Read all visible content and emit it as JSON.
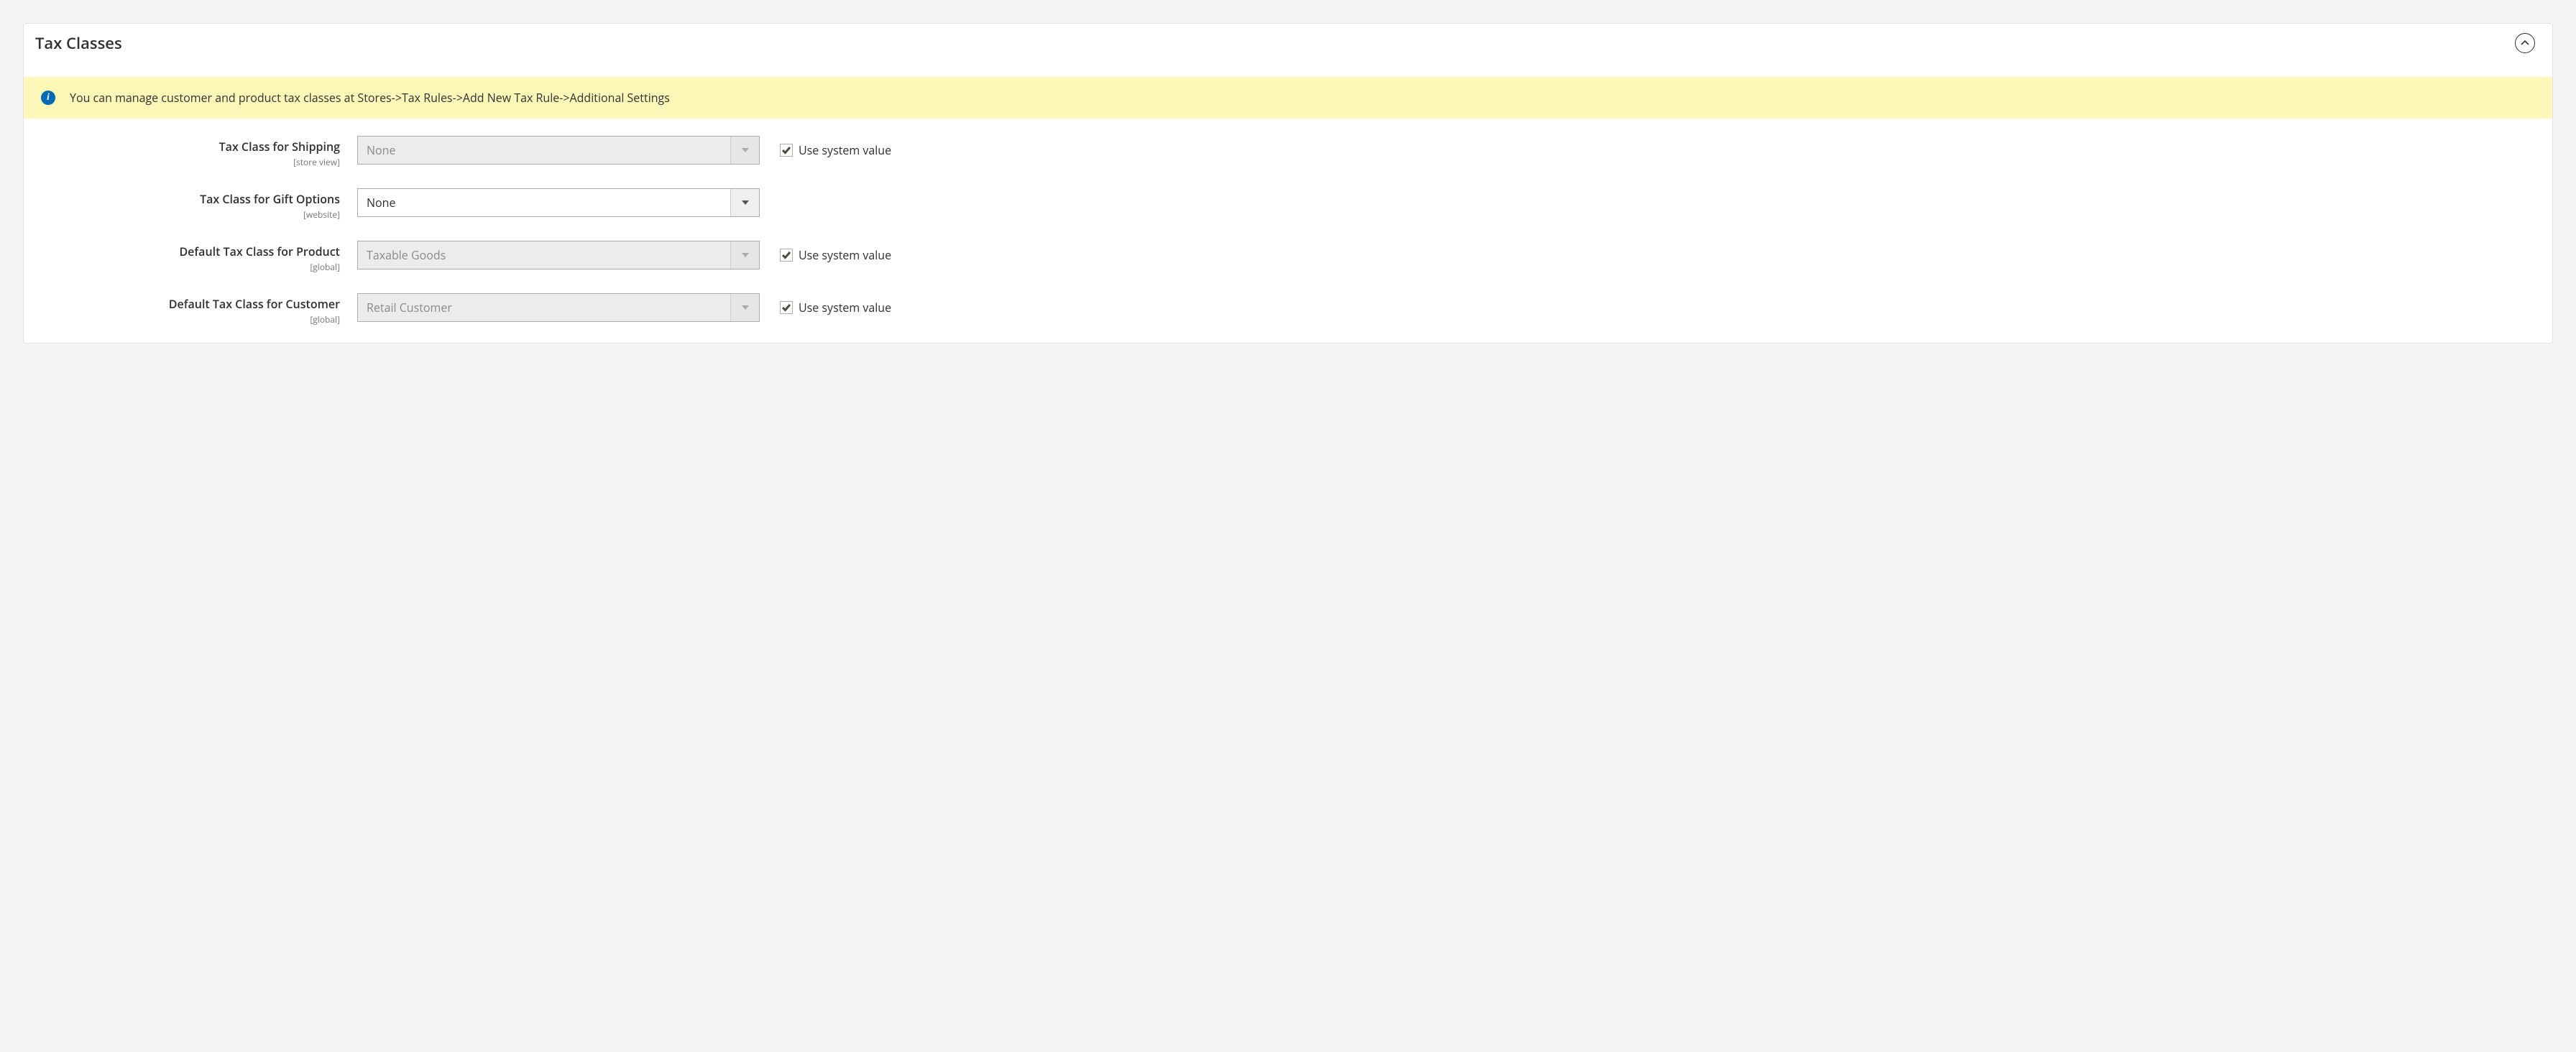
{
  "section": {
    "title": "Tax Classes",
    "notice": "You can manage customer and product tax classes at Stores->Tax Rules->Add New Tax Rule->Additional Settings",
    "use_system_label": "Use system value"
  },
  "fields": {
    "shipping": {
      "label": "Tax Class for Shipping",
      "scope": "[store view]",
      "value": "None",
      "disabled": true,
      "use_system": true
    },
    "gift": {
      "label": "Tax Class for Gift Options",
      "scope": "[website]",
      "value": "None",
      "disabled": false,
      "use_system": false
    },
    "product": {
      "label": "Default Tax Class for Product",
      "scope": "[global]",
      "value": "Taxable Goods",
      "disabled": true,
      "use_system": true
    },
    "customer": {
      "label": "Default Tax Class for Customer",
      "scope": "[global]",
      "value": "Retail Customer",
      "disabled": true,
      "use_system": true
    }
  }
}
